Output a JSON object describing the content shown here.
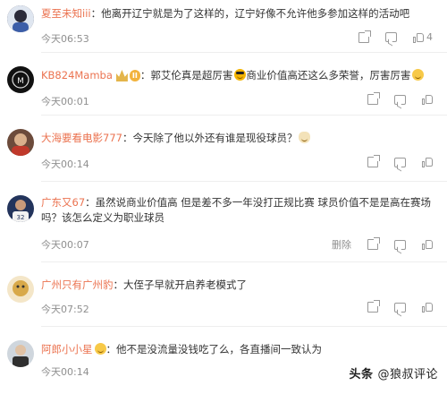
{
  "comments": [
    {
      "user": "夏至未知iii",
      "text": "他离开辽宁就是为了这样的，辽宁好像不允许他多参加这样的活动吧",
      "time": "今天06:53",
      "likes": "4",
      "avatar_color": "#3b3b4a"
    },
    {
      "user": "KB824Mamba",
      "badge_level": "II",
      "text": "郭艾伦真是超厉害",
      "text_after": "商业价值高还这么多荣誉，厉害厉害",
      "time": "今天00:01",
      "likes": "",
      "avatar_color": "#1a1a1a"
    },
    {
      "user": "大海要看电影777",
      "text": "今天除了他以外还有谁是现役球员？",
      "time": "今天00:14",
      "likes": "",
      "avatar_color": "#7a4a3a"
    },
    {
      "user": "广东又67",
      "text": "虽然说商业价值高 但是差不多一年没打正规比赛 球员价值不是是高在赛场吗？该怎么定义为职业球员",
      "time": "今天00:07",
      "delete_label": "删除",
      "likes": "",
      "avatar_color": "#2d3e6b"
    },
    {
      "user": "广州只有广州豹",
      "text": "大侄子早就开启养老模式了",
      "time": "今天07:52",
      "likes": "",
      "avatar_color": "#c9a24a"
    },
    {
      "user": "阿郎小小星",
      "text": "他不是没流量没钱吃了么，各直播间一致认为",
      "time": "今天00:14",
      "likes": "",
      "avatar_color": "#3c3c3c"
    }
  ],
  "watermark": {
    "brand": "头条",
    "handle": "@狼叔评论"
  }
}
